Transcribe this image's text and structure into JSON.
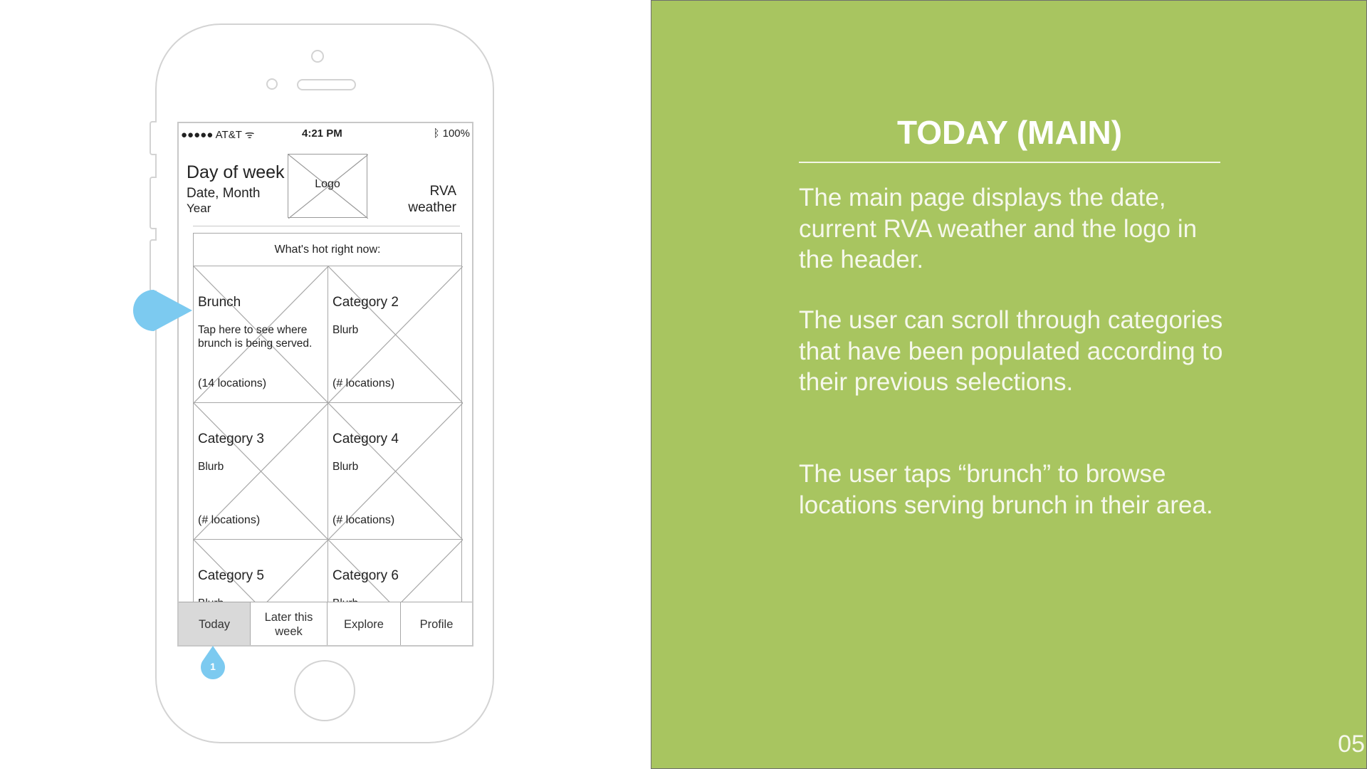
{
  "phone": {
    "status_bar": {
      "carrier": "●●●●● AT&T",
      "time": "4:21 PM",
      "battery": "100%"
    },
    "header": {
      "day_of_week": "Day of week",
      "date_month": "Date, Month",
      "year": "Year",
      "logo": "Logo",
      "weather_line1": "RVA",
      "weather_line2": "weather"
    },
    "hot_section": {
      "title": "What's hot right now:",
      "tiles": [
        {
          "title": "Brunch",
          "blurb": "Tap here to see where brunch is being served.",
          "count": "(14 locations)"
        },
        {
          "title": "Category 2",
          "blurb": "Blurb",
          "count": "(# locations)"
        },
        {
          "title": "Category 3",
          "blurb": "Blurb",
          "count": "(# locations)"
        },
        {
          "title": "Category 4",
          "blurb": "Blurb",
          "count": "(# locations)"
        },
        {
          "title": "Category 5",
          "blurb": "Blurb",
          "count": ""
        },
        {
          "title": "Category 6",
          "blurb": "Blurb",
          "count": ""
        }
      ]
    },
    "tabs": [
      {
        "label": "Today",
        "active": true
      },
      {
        "label": "Later this week",
        "active": false
      },
      {
        "label": "Explore",
        "active": false
      },
      {
        "label": "Profile",
        "active": false
      }
    ],
    "marker_label": "1"
  },
  "info": {
    "title": "TODAY (MAIN)",
    "paragraphs": [
      "The main page displays the date, current RVA weather and the logo in the header.",
      "The user can scroll through categories that have been populated according to their previous selections.",
      "The user taps “brunch” to browse locations serving brunch in their area."
    ],
    "page_number": "05"
  },
  "colors": {
    "panel_green": "#a8c560",
    "marker_blue": "#7ccaf0",
    "wire_gray": "#a8a8a8"
  }
}
